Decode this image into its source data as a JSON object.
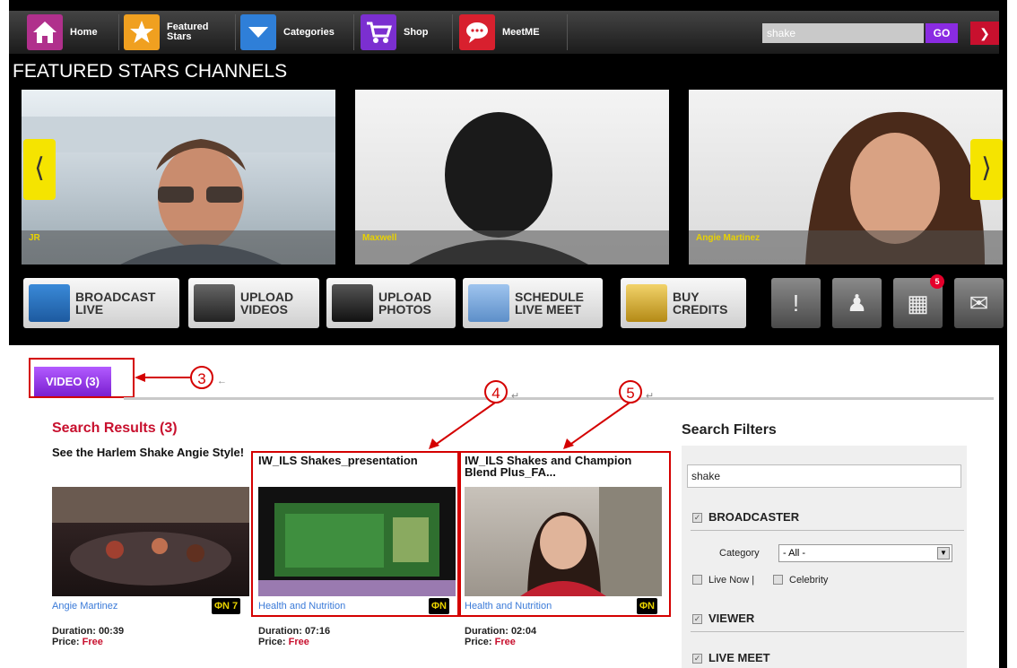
{
  "nav": {
    "items": [
      {
        "label": "Home",
        "icon": "home-icon",
        "color": "#b0308c"
      },
      {
        "label": "Featured\nStars",
        "icon": "star-icon",
        "color": "#f0a020"
      },
      {
        "label": "Categories",
        "icon": "chevron-down-icon",
        "color": "#2f7fd8"
      },
      {
        "label": "Shop",
        "icon": "cart-icon",
        "color": "#7b2fd0"
      },
      {
        "label": "MeetME",
        "icon": "chat-icon",
        "color": "#d8202e"
      }
    ],
    "search_value": "shake",
    "go_label": "GO"
  },
  "featured": {
    "title": "FEATURED STARS CHANNELS",
    "cards": [
      {
        "name": "JR"
      },
      {
        "name": "Maxwell"
      },
      {
        "name": "Angie Martinez"
      }
    ]
  },
  "actions": [
    {
      "label": "BROADCAST\nLIVE",
      "icon": "broadcast-icon"
    },
    {
      "label": "UPLOAD\nVIDEOS",
      "icon": "video-camera-icon"
    },
    {
      "label": "UPLOAD\nPHOTOS",
      "icon": "photo-camera-icon"
    },
    {
      "label": "SCHEDULE\nLIVE MEET",
      "icon": "calendar-icon"
    },
    {
      "label": "BUY\nCREDITS",
      "icon": "coins-icon"
    }
  ],
  "small_actions": {
    "alert_icon": "alert-icon",
    "users_icon": "users-icon",
    "calendar_icon": "calendar-icon",
    "mail_icon": "mail-icon",
    "calendar_badge": "5"
  },
  "tab": {
    "label": "VIDEO (3)"
  },
  "annotations": [
    "3",
    "4",
    "5"
  ],
  "results": {
    "title": "Search Results (3)",
    "videos": [
      {
        "title": "See the Harlem Shake Angie Style!",
        "channel": "Angie Martinez",
        "badge": "ΦN 7",
        "duration": "Duration: 00:39",
        "price_label": "Price:",
        "price": "Free"
      },
      {
        "title": "IW_ILS Shakes_presentation",
        "channel": "Health and Nutrition",
        "badge": "ΦN",
        "duration": "Duration: 07:16",
        "price_label": "Price:",
        "price": "Free"
      },
      {
        "title": "IW_ILS Shakes and Champion Blend Plus_FA...",
        "channel": "Health and Nutrition",
        "badge": "ΦN",
        "duration": "Duration: 02:04",
        "price_label": "Price:",
        "price": "Free"
      }
    ]
  },
  "filters": {
    "title": "Search Filters",
    "query": "shake",
    "broadcaster": "BROADCASTER",
    "category_label": "Category",
    "category_value": "- All -",
    "live_now": "Live Now |",
    "celebrity": "Celebrity",
    "viewer": "VIEWER",
    "live_meet": "LIVE MEET"
  }
}
